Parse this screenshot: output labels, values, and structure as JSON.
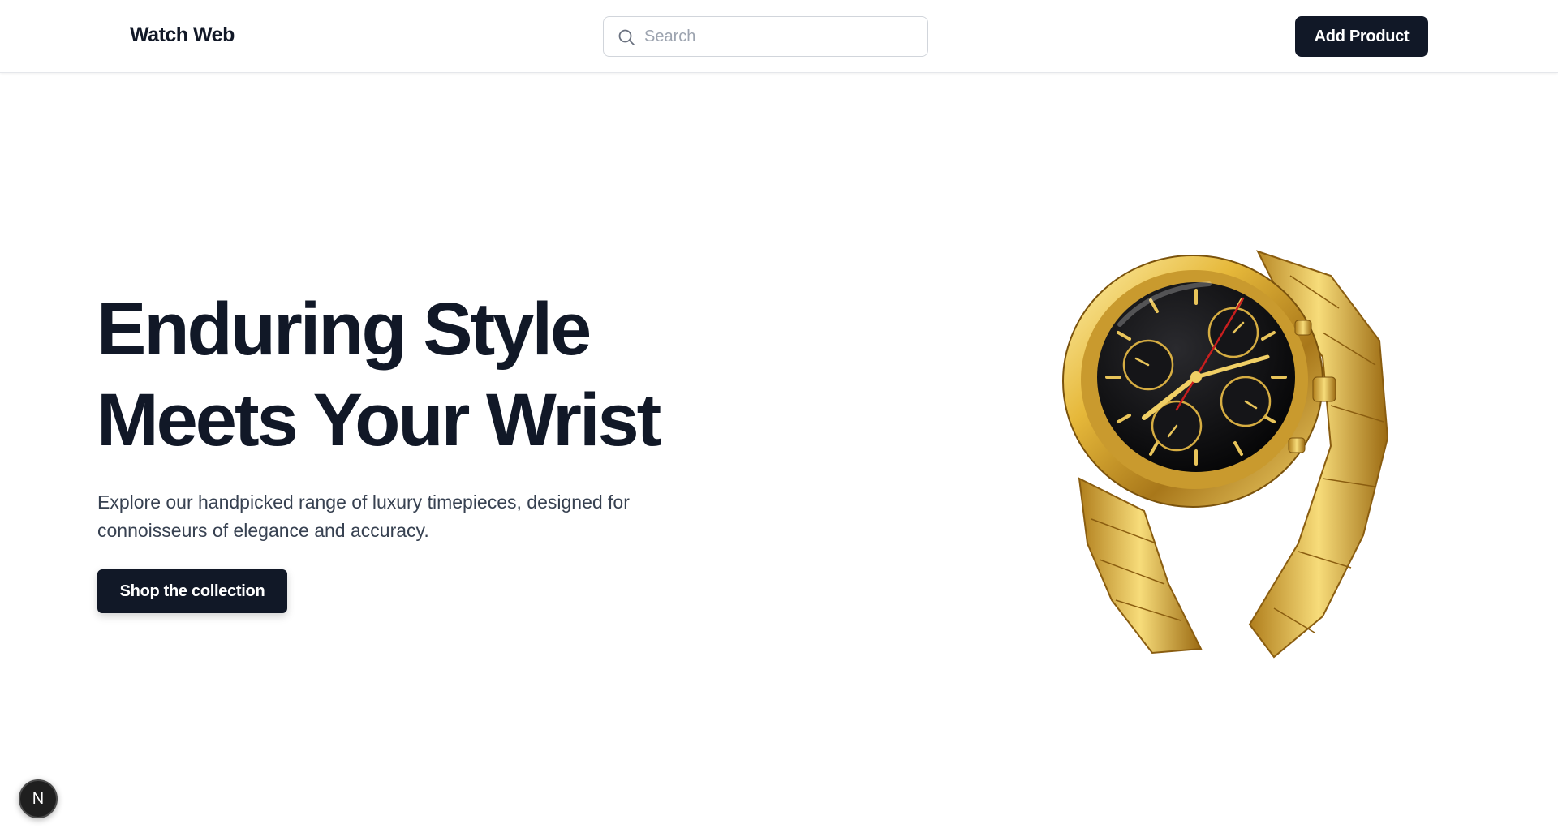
{
  "header": {
    "brand": "Watch Web",
    "search_placeholder": "Search",
    "search_value": "",
    "add_product_label": "Add Product"
  },
  "hero": {
    "title_line1": "Enduring Style",
    "title_line2": "Meets Your Wrist",
    "description": "Explore our handpicked range of luxury timepieces, designed for connoisseurs of elegance and accuracy.",
    "cta_label": "Shop the collection",
    "image_subject": "gold-chronograph-watch"
  },
  "dev_badge": {
    "letter": "N"
  },
  "colors": {
    "primary": "#111827",
    "text_muted": "#374151",
    "border": "#d1d5db",
    "watch_gold": "#d4a52c",
    "watch_dial": "#0b0b0d",
    "second_hand": "#c81e1e"
  }
}
